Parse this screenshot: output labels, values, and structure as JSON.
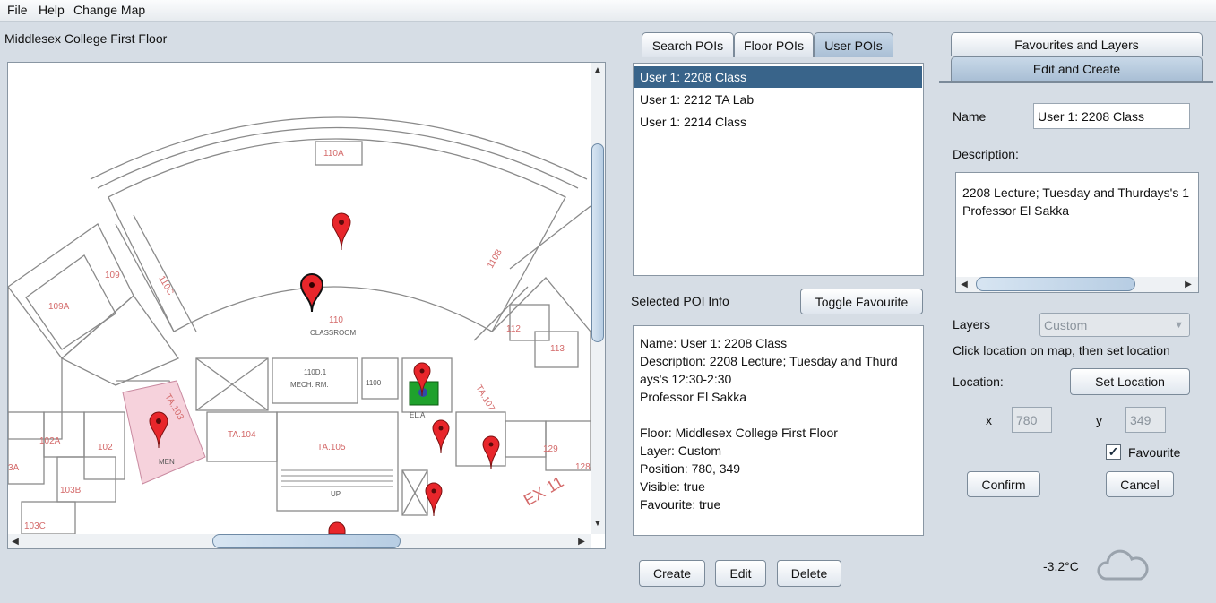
{
  "menu": [
    "File",
    "Help",
    "Change Map"
  ],
  "map": {
    "title": "Middlesex College First Floor",
    "rooms": [
      "110A",
      "109",
      "110C",
      "109A",
      "110",
      "CLASSROOM",
      "110D.1",
      "MECH. RM.",
      "1100",
      "112",
      "113",
      "110B",
      "102A",
      "102",
      "TA.104",
      "TA.105",
      "UP",
      "TA.103",
      "MEN",
      "103B",
      "103C",
      "3A",
      "EL.A",
      "TA.107",
      "129",
      "128",
      "EX 11"
    ]
  },
  "poi_tabs": [
    "Search POIs",
    "Floor POIs",
    "User POIs"
  ],
  "poi_list": [
    "User 1: 2208 Class",
    "User 1: 2212 TA Lab",
    "User 1: 2214 Class"
  ],
  "selected_info": {
    "label": "Selected POI Info",
    "toggle_button": "Toggle Favourite",
    "lines": [
      "Name: User 1: 2208 Class",
      "Description: 2208 Lecture; Tuesday and Thurd",
      "ays's 12:30-2:30",
      "Professor El Sakka",
      "",
      "Floor: Middlesex College First Floor",
      "Layer: Custom",
      "Position: 780, 349",
      "Visible: true",
      "Favourite: true"
    ]
  },
  "actions": {
    "create": "Create",
    "edit": "Edit",
    "delete": "Delete"
  },
  "right_tabs": {
    "favourites": "Favourites and Layers",
    "edit": "Edit and Create"
  },
  "form": {
    "name_label": "Name",
    "name_value": "User 1: 2208 Class",
    "description_label": "Description:",
    "description_lines": [
      "2208 Lecture; Tuesday and Thurdays's 1",
      "Professor El Sakka"
    ],
    "layers_label": "Layers",
    "layers_value": "Custom",
    "hint": "Click location on map, then set location",
    "location_label": "Location:",
    "set_location": "Set Location",
    "x_label": "x",
    "x_value": "780",
    "y_label": "y",
    "y_value": "349",
    "favourite_label": "Favourite",
    "favourite_checked": true,
    "confirm": "Confirm",
    "cancel": "Cancel"
  },
  "weather": {
    "temperature": "-3.2°C",
    "icon": "cloud-icon"
  },
  "colors": {
    "selection": "#39648a",
    "pin": "#e8262b",
    "restroom": "#f6d2dc",
    "highlight": "#1fa12c"
  }
}
